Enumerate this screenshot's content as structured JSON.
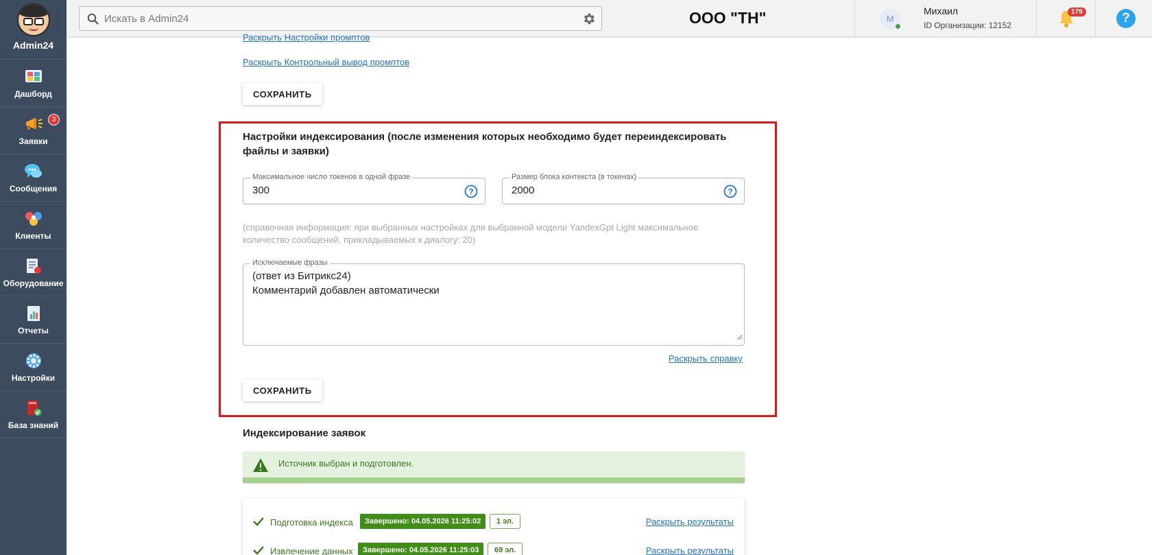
{
  "app": {
    "name": "Admin24"
  },
  "sidebar": {
    "items": [
      {
        "label": "Дашборд",
        "icon": "dashboard-icon"
      },
      {
        "label": "Заявки",
        "icon": "megaphone-icon",
        "badge": "3"
      },
      {
        "label": "Сообщения",
        "icon": "chat-icon"
      },
      {
        "label": "Клиенты",
        "icon": "clients-icon"
      },
      {
        "label": "Оборудование",
        "icon": "equipment-icon"
      },
      {
        "label": "Отчеты",
        "icon": "reports-icon"
      },
      {
        "label": "Настройки",
        "icon": "gear-icon"
      },
      {
        "label": "База знаний",
        "icon": "knowledge-base-icon"
      }
    ]
  },
  "topbar": {
    "search_placeholder": "Искать в Admin24",
    "org_title": "ООО \"ТН\"",
    "user_initial": "М",
    "user_name": "Михаил",
    "org_id": "ID Организации: 12152",
    "notifications_count": "179",
    "help_label": "?"
  },
  "content": {
    "link_prompt_settings": "Раскрыть Настройки промптов",
    "link_control_output": "Раскрыть Контрольный вывод промптов",
    "save_label": "СОХРАНИТЬ",
    "indexing": {
      "title": "Настройки индексирования (после изменения которых необходимо будет переиндексировать файлы и заявки)",
      "max_tokens_label": "Максимальное число токенов в одной фразе",
      "max_tokens_value": "300",
      "context_block_label": "Размер блока контекста (в токенах)",
      "context_block_value": "2000",
      "hint": "(справочная информация: при выбранных настройках для выбранной модели YandexGpt Light максимальное количество сообщений, прикладываемых к диалогу: 20)",
      "excluded_label": "Исключаемые фразы",
      "excluded_lines": [
        "(ответ из Битрикс24)",
        "Комментарий добавлен автоматически"
      ],
      "help_link": "Раскрыть справку",
      "save_label": "СОХРАНИТЬ"
    },
    "requests_indexing": {
      "title": "Индексирование заявок",
      "alert_text": "Источник выбран и подготовлен.",
      "rows": [
        {
          "label": "Подготовка индекса",
          "status": "Завершено: 04.05.2026 11:25:02",
          "count": "1 эл.",
          "link": "Раскрыть результаты"
        },
        {
          "label": "Извлечение данных",
          "status": "Завершено: 04.05.2026 11:25:03",
          "count": "69 эл.",
          "link": "Раскрыть результаты"
        }
      ]
    }
  },
  "colors": {
    "sidebar_bg": "#3d4b5e",
    "highlight_frame": "#e31414",
    "success_green": "#3f8f17",
    "link_blue": "#1e73d6"
  }
}
